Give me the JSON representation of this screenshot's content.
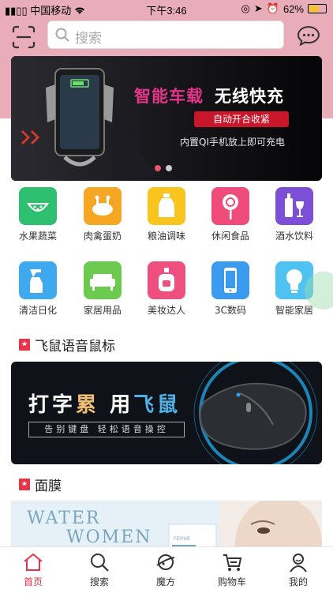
{
  "status_bar": {
    "carrier": "中国移动",
    "time": "下午3:46",
    "battery": "62%",
    "battery_level": 0.62
  },
  "header": {
    "search_placeholder": "搜索"
  },
  "banner": {
    "headline_pink": "智能车载",
    "headline_white": "无线快充",
    "tag": "自动开合收紧",
    "subtitle": "内置QI手机放上即可充电",
    "slide_count": 2,
    "active_slide": 1
  },
  "categories": [
    {
      "label": "水果蔬菜",
      "icon": "watermelon-icon",
      "color": "#2fbf71"
    },
    {
      "label": "肉禽蛋奶",
      "icon": "chicken-icon",
      "color": "#f5a623"
    },
    {
      "label": "粮油调味",
      "icon": "oil-bottle-icon",
      "color": "#f7c51e"
    },
    {
      "label": "休闲食品",
      "icon": "lollipop-icon",
      "color": "#ef4c7c"
    },
    {
      "label": "酒水饮料",
      "icon": "wine-icon",
      "color": "#7c4fd6"
    },
    {
      "label": "清洁日化",
      "icon": "spray-bottle-icon",
      "color": "#3ea9ee"
    },
    {
      "label": "家居用品",
      "icon": "sofa-icon",
      "color": "#6ccb4e"
    },
    {
      "label": "美妆达人",
      "icon": "perfume-icon",
      "color": "#ee4f7e"
    },
    {
      "label": "3C数码",
      "icon": "phone-icon",
      "color": "#3b9bef"
    },
    {
      "label": "智能家居",
      "icon": "lightbulb-icon",
      "color": "#4ec3f2"
    }
  ],
  "sections": [
    {
      "title": "飞鼠语音鼠标"
    },
    {
      "title": "面膜"
    }
  ],
  "mouse_banner": {
    "line1_a": "打字",
    "line1_b": "累",
    "line1_c": " 用",
    "line1_d": "飞鼠",
    "line2": "告别键盘 轻松语音操控"
  },
  "mask_banner": {
    "line1": "WATER",
    "line2": "WOMEN",
    "brand": "FEIYUE"
  },
  "tabbar": [
    {
      "label": "首页",
      "icon": "home-icon",
      "active": true
    },
    {
      "label": "搜索",
      "icon": "search-icon",
      "active": false
    },
    {
      "label": "魔方",
      "icon": "planet-icon",
      "active": false
    },
    {
      "label": "购物车",
      "icon": "cart-icon",
      "active": false
    },
    {
      "label": "我的",
      "icon": "user-icon",
      "active": false
    }
  ],
  "colors": {
    "header_pink": "#e8adb8",
    "accent_red": "#e8334a"
  }
}
